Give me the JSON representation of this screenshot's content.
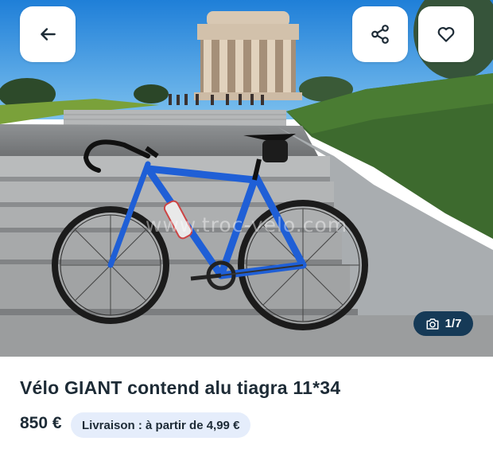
{
  "header": {
    "back_icon": "arrow-left-icon",
    "share_icon": "share-icon",
    "favorite_icon": "heart-icon"
  },
  "photo": {
    "watermark": "www.troc-velo.com",
    "counter_icon": "camera-icon",
    "counter": "1/7"
  },
  "listing": {
    "title": "Vélo GIANT contend alu tiagra 11*34",
    "price": "850 €",
    "delivery": "Livraison : à partir de 4,99 €"
  },
  "colors": {
    "bike_frame": "#1f5fd6",
    "counter_badge": "#163a57",
    "delivery_badge": "#e5edfb",
    "text": "#1d2b36"
  }
}
